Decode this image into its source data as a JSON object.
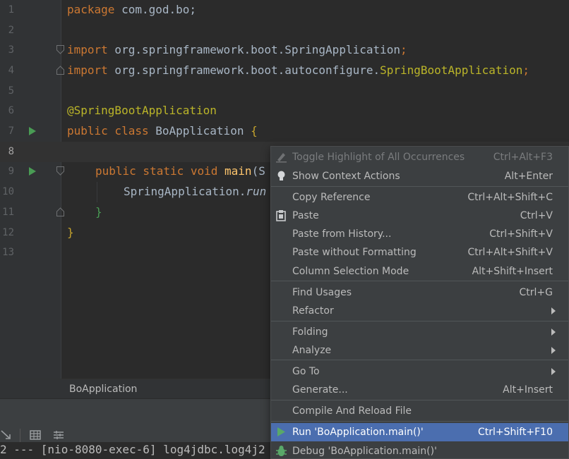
{
  "editor": {
    "line_numbers": [
      "1",
      "2",
      "3",
      "4",
      "5",
      "6",
      "7",
      "8",
      "9",
      "10",
      "11",
      "12",
      "13"
    ],
    "code": {
      "l1_kw": "package",
      "l1_rest": " com.god.bo;",
      "l3_kw": "import",
      "l3_rest": " org.springframework.boot.SpringApplication",
      "l3_semi": ";",
      "l4_kw": "import",
      "l4_rest": " org.springframework.boot.autoconfigure.",
      "l4_cls": "SpringBootApplication",
      "l4_semi": ";",
      "l6_ann": "@SpringBootApplication",
      "l7_kw": "public class",
      "l7_rest": " BoApplication ",
      "l7_brace": "{",
      "l9_kw": "public static void",
      "l9_fn": " main",
      "l9_rest": "(S",
      "l10_cls": "SpringApplication.",
      "l10_it": "run",
      "l11_brace": "}",
      "l12_brace": "}"
    }
  },
  "breadcrumb": {
    "text": "BoApplication"
  },
  "console": {
    "text": "2 --- [nio-8080-exec-6] log4jdbc.log4j2"
  },
  "context_menu": {
    "items": [
      {
        "label": "Toggle Highlight of All Occurrences",
        "shortcut": "Ctrl+Alt+F3",
        "icon": "highlighter-icon"
      },
      {
        "label": "Show Context Actions",
        "shortcut": "Alt+Enter",
        "icon": "lightbulb-icon"
      },
      {
        "label": "Copy Reference",
        "shortcut": "Ctrl+Alt+Shift+C"
      },
      {
        "label": "Paste",
        "shortcut": "Ctrl+V",
        "icon": "clipboard-icon"
      },
      {
        "label": "Paste from History...",
        "shortcut": "Ctrl+Shift+V"
      },
      {
        "label": "Paste without Formatting",
        "shortcut": "Ctrl+Alt+Shift+V"
      },
      {
        "label": "Column Selection Mode",
        "shortcut": "Alt+Shift+Insert"
      },
      {
        "label": "Find Usages",
        "shortcut": "Ctrl+G"
      },
      {
        "label": "Refactor",
        "shortcut": ""
      },
      {
        "label": "Folding",
        "shortcut": ""
      },
      {
        "label": "Analyze",
        "shortcut": ""
      },
      {
        "label": "Go To",
        "shortcut": ""
      },
      {
        "label": "Generate...",
        "shortcut": "Alt+Insert"
      },
      {
        "label": "Compile And Reload File",
        "shortcut": ""
      },
      {
        "label": "Run 'BoApplication.main()'",
        "shortcut": "Ctrl+Shift+F10",
        "icon": "run-icon"
      },
      {
        "label": "Debug 'BoApplication.main()'",
        "shortcut": "",
        "icon": "debug-icon"
      }
    ]
  },
  "colors": {
    "selection": "#4b6eaf",
    "run_green": "#499c54",
    "keyword": "#cc7832",
    "annotation": "#bbb529",
    "function": "#ffc66d"
  }
}
